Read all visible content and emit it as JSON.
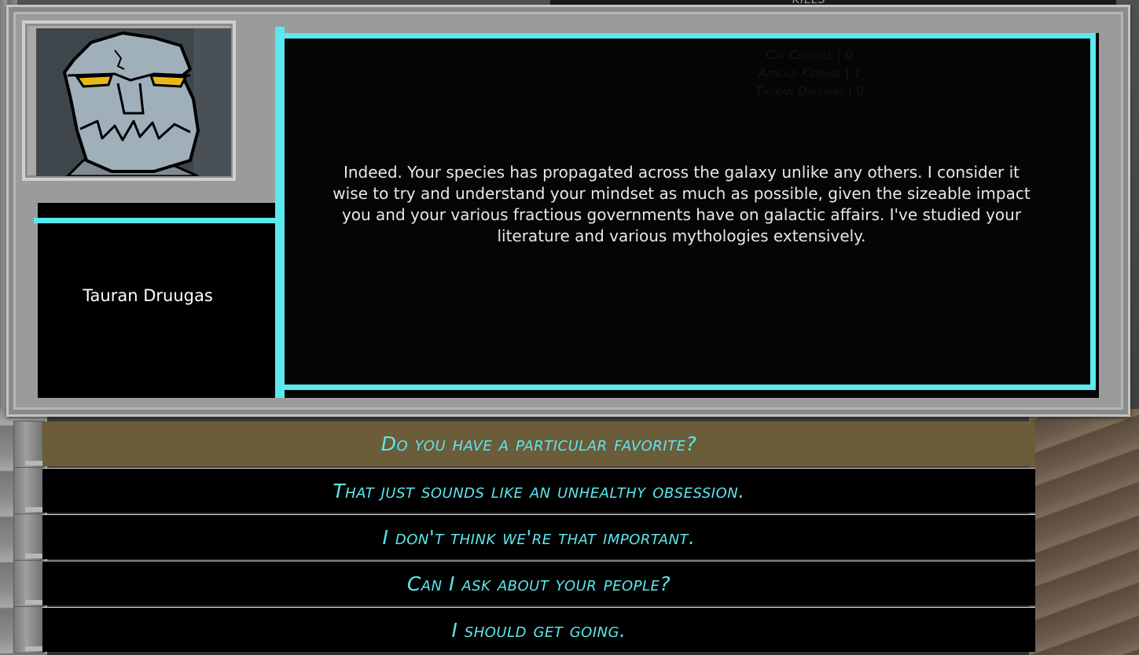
{
  "background": {
    "top_label": "KILLS"
  },
  "speaker": {
    "name": "Tauran Druugas"
  },
  "dialogue": {
    "text": "Indeed. Your species has propagated across the galaxy unlike any others. I consider it wise to try and understand your mindset as much as possible, given the sizeable impact you and your various fractious governments have on galactic affairs. I've studied your literature and various mythologies extensively."
  },
  "ghost_scores": [
    "Cat Cheadle | 0",
    "Arnold Kenmar | 1",
    "Tauran Druugas | 0"
  ],
  "choices": [
    {
      "label": "Do you have a particular favorite?",
      "selected": true
    },
    {
      "label": "That just sounds like an unhealthy obsession.",
      "selected": false
    },
    {
      "label": "I don't think we're that important.",
      "selected": false
    },
    {
      "label": "Can I ask about your people?",
      "selected": false
    },
    {
      "label": "I should get going.",
      "selected": false
    }
  ],
  "colors": {
    "accent": "#5be8ee",
    "selected_choice": "#6b5c3a",
    "frame": "#9b9b9b"
  }
}
